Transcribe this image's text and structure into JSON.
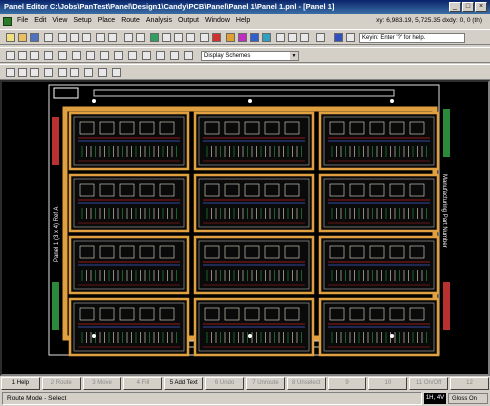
{
  "window": {
    "title": "Panel Editor  C:\\Jobs\\PanTest\\Panel\\Design1\\Candy\\PCB\\Panel\\Panel 1\\Panel 1.pnl - [Panel 1]",
    "minimize": "_",
    "maximize": "□",
    "close": "×"
  },
  "menu": [
    "File",
    "Edit",
    "View",
    "Setup",
    "Place",
    "Route",
    "Analysis",
    "Output",
    "Window",
    "Help"
  ],
  "coords": "xy: 6,983.19, 5,725.35   dxdy: 0, 0  (th)",
  "toolbar": {
    "keyin_placeholder": "Keyin: Enter '?' for help.",
    "display_scheme": "Display Schemes"
  },
  "canvas": {
    "left_label": "Panel 1 (3 x 4) Ref A",
    "right_label": "Manufacturing Part Number",
    "colors": {
      "rail": "#e0a040",
      "copper": "#e8e0d0",
      "trace_red": "#c02020",
      "trace_blue": "#4060d0",
      "trace_green": "#20a040"
    }
  },
  "fkeys": [
    {
      "label": "1 Help",
      "active": true
    },
    {
      "label": "2 Route",
      "active": false
    },
    {
      "label": "3 Move",
      "active": false
    },
    {
      "label": "4 Fill",
      "active": false
    },
    {
      "label": "5 Add Text",
      "active": true
    },
    {
      "label": "6 Undo",
      "active": false
    },
    {
      "label": "7 Unroute",
      "active": false
    },
    {
      "label": "8 Unselect",
      "active": false
    },
    {
      "label": "9",
      "active": false
    },
    {
      "label": "10",
      "active": false
    },
    {
      "label": "11 On/Off",
      "active": false
    },
    {
      "label": "12",
      "active": false
    }
  ],
  "status": {
    "mode": "Route Mode - Select",
    "indicator": "1H, 4V",
    "gloss": "Gloss On"
  }
}
